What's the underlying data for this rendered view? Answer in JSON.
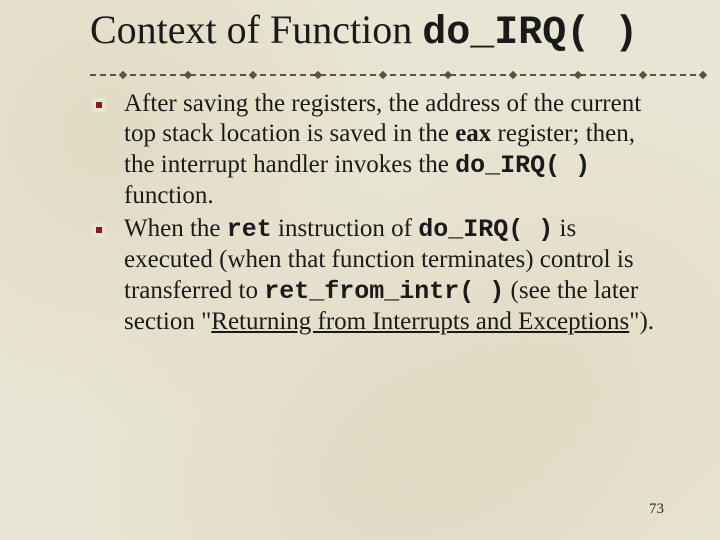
{
  "title": {
    "prefix": "Context of Function ",
    "code": "do_IRQ( )"
  },
  "bullets": [
    {
      "parts": [
        {
          "t": "After saving the registers, the address of the current top stack location is saved in the "
        },
        {
          "t": "eax",
          "cls": "bold"
        },
        {
          "t": " register; then, the interrupt handler invokes the "
        },
        {
          "t": "do_IRQ( )",
          "cls": "code-inline"
        },
        {
          "t": " function."
        }
      ]
    },
    {
      "parts": [
        {
          "t": "When the "
        },
        {
          "t": "ret",
          "cls": "code-inline"
        },
        {
          "t": " instruction of "
        },
        {
          "t": "do_IRQ( )",
          "cls": "code-inline"
        },
        {
          "t": " is executed (when that function terminates) control is transferred to "
        },
        {
          "t": "ret_from_intr( )",
          "cls": "code-inline"
        },
        {
          "t": " (see the later section \""
        },
        {
          "t": "Returning from Interrupts and Exceptions",
          "cls": "link"
        },
        {
          "t": "\")."
        }
      ]
    }
  ],
  "page_number": "73"
}
